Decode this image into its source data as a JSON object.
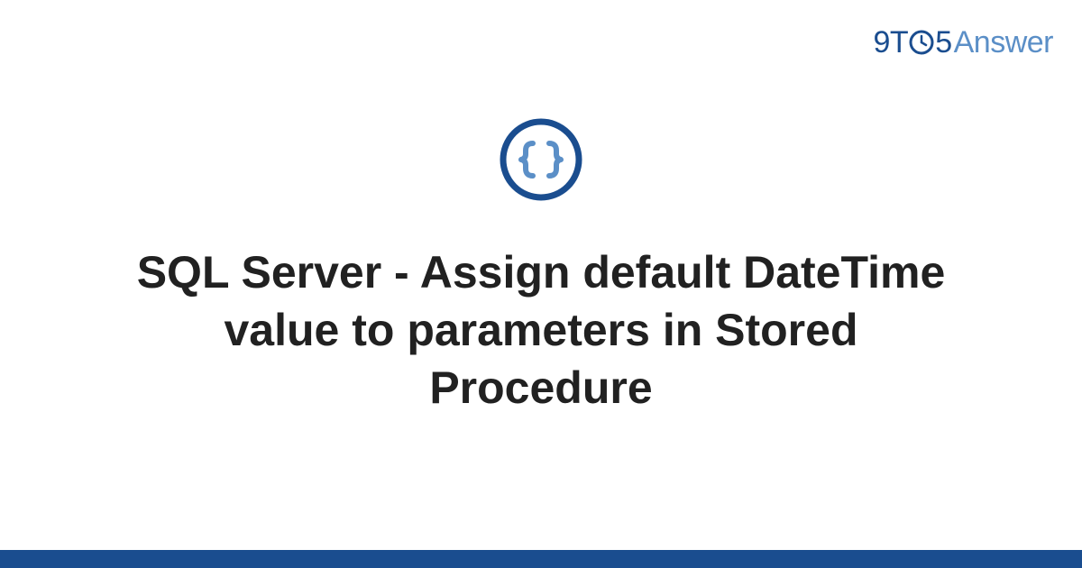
{
  "brand": {
    "prefix": "9T",
    "clock_icon": "clock-icon",
    "middle": "5",
    "suffix": "Answer"
  },
  "category": {
    "icon_name": "code-braces-icon"
  },
  "page": {
    "title": "SQL Server - Assign default DateTime value to parameters in Stored Procedure"
  },
  "colors": {
    "brand_primary": "#1a4d8f",
    "brand_secondary": "#5b8fc7",
    "icon_inner": "#5b8fc7",
    "text": "#212121"
  }
}
